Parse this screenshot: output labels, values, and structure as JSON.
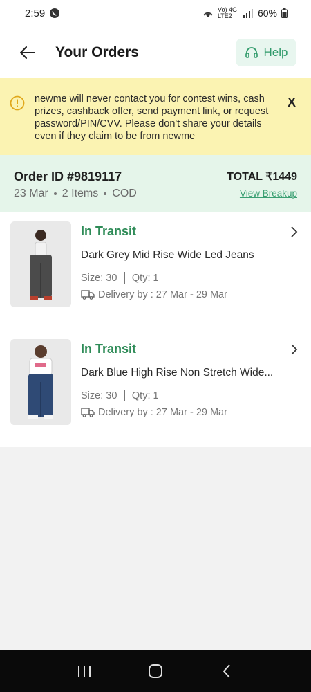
{
  "status_bar": {
    "time": "2:59",
    "battery": "60%",
    "network": "Vo) 4G LTE2"
  },
  "header": {
    "title": "Your Orders",
    "help_label": "Help"
  },
  "notice": {
    "text": "newme will never contact you for contest wins, cash prizes, cashback offer, send payment link, or request password/PIN/CVV. Please don't share your details even if they claim to be from newme",
    "close_label": "X"
  },
  "order": {
    "id_label": "Order ID #9819117",
    "date": "23 Mar",
    "items_count": "2 Items",
    "payment": "COD",
    "total_label": "TOTAL ₹1449",
    "view_breakup_label": "View Breakup"
  },
  "items": [
    {
      "status": "In Transit",
      "name": "Dark Grey Mid Rise Wide Led Jeans",
      "size": "Size: 30",
      "qty": "Qty: 1",
      "delivery": "Delivery by : 27 Mar - 29 Mar"
    },
    {
      "status": "In Transit",
      "name": "Dark Blue High Rise Non Stretch Wide...",
      "size": "Size: 30",
      "qty": "Qty: 1",
      "delivery": "Delivery by : 27 Mar - 29 Mar"
    }
  ],
  "colors": {
    "accent_green": "#2e8b57",
    "notice_bg": "#fbf3b2",
    "summary_bg": "#e5f5ea"
  },
  "icons": {
    "back": "arrow-left-icon",
    "help": "headset-icon",
    "notice": "info-circle-icon",
    "delivery": "truck-icon",
    "chevron": "chevron-right-icon"
  }
}
